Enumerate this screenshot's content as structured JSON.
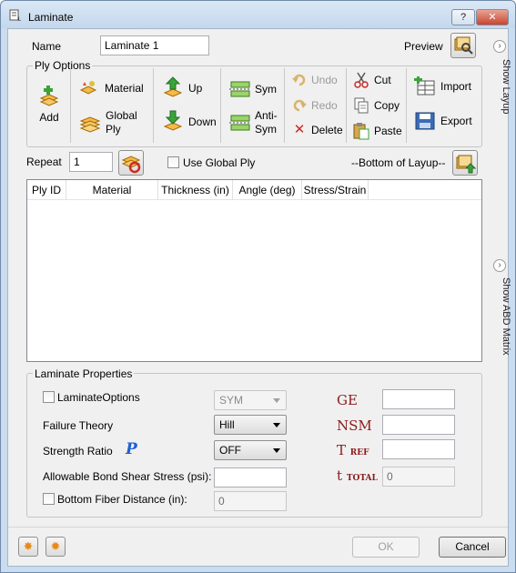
{
  "window": {
    "title": "Laminate",
    "help_label": "?",
    "close_label": "✕"
  },
  "name": {
    "label": "Name",
    "value": "Laminate 1"
  },
  "preview": {
    "label": "Preview"
  },
  "ply_options": {
    "title": "Ply Options",
    "add": "Add",
    "material": "Material",
    "global_ply": "Global\nPly",
    "up": "Up",
    "down": "Down",
    "sym": "Sym",
    "anti_sym": "Anti-\nSym",
    "undo": "Undo",
    "redo": "Redo",
    "delete": "Delete",
    "cut": "Cut",
    "copy": "Copy",
    "paste": "Paste",
    "import": "Import",
    "export": "Export"
  },
  "repeat": {
    "label": "Repeat",
    "value": "1"
  },
  "use_global_ply": {
    "label": "Use Global Ply",
    "checked": false
  },
  "bottom_of_layup": "--Bottom of Layup--",
  "table": {
    "columns": [
      "Ply ID",
      "Material",
      "Thickness (in)",
      "Angle (deg)",
      "Stress/Strain"
    ],
    "rows": []
  },
  "side_panels": {
    "show_layup": "Show Layup",
    "show_abd": "Show ABD Matrix"
  },
  "laminate_properties": {
    "title": "Laminate Properties",
    "laminate_options": {
      "label": "LaminateOptions",
      "checked": false,
      "value": "SYM"
    },
    "failure_theory": {
      "label": "Failure Theory",
      "value": "Hill"
    },
    "strength_ratio": {
      "label": "Strength Ratio",
      "symbol": "P",
      "value": "OFF"
    },
    "allowable_bond": {
      "label": "Allowable Bond Shear Stress (psi):",
      "value": ""
    },
    "bottom_fiber": {
      "label": "Bottom Fiber Distance (in):",
      "checked": false,
      "value": "0"
    },
    "ge": {
      "label": "GE",
      "value": ""
    },
    "nsm": {
      "label": "NSM",
      "value": ""
    },
    "tref": {
      "label": "T",
      "sub": "REF",
      "value": ""
    },
    "ttotal": {
      "label": "t",
      "sub": "TOTAL",
      "value": "0"
    }
  },
  "footer": {
    "ok": "OK",
    "cancel": "Cancel"
  },
  "colors": {
    "accent": "#8b1a1a",
    "frame": "#c9dcf0",
    "title_close": "#c8452f"
  }
}
